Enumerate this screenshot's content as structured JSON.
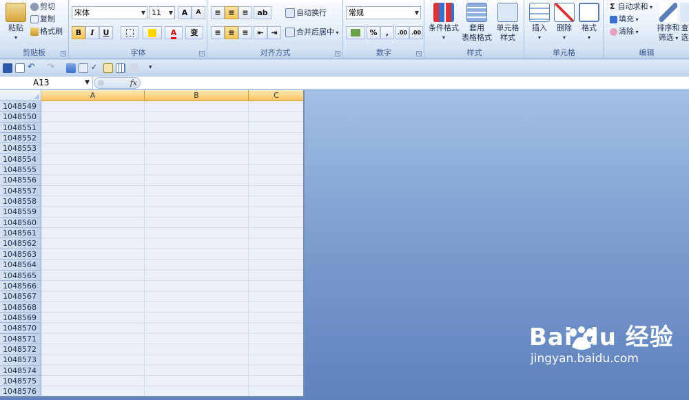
{
  "ribbon": {
    "clipboard": {
      "label": "剪贴板",
      "paste": "粘贴",
      "cut": "剪切",
      "copy": "复制",
      "format_painter": "格式刷"
    },
    "font": {
      "label": "字体",
      "font_name": "宋体",
      "font_size": "11",
      "bold": "B",
      "italic": "I",
      "underline": "U",
      "grow": "A",
      "shrink": "A",
      "font_color": "A",
      "phonetic": "变"
    },
    "alignment": {
      "label": "对齐方式",
      "wrap_text": "自动换行",
      "merge_center": "合并后居中"
    },
    "number": {
      "label": "数字",
      "format": "常规",
      "percent": "%",
      "comma": ",",
      "inc_decimal": ".00",
      "dec_decimal": ".00"
    },
    "styles": {
      "label": "样式",
      "conditional": "条件格式",
      "table_format_1": "套用",
      "table_format_2": "表格格式",
      "cell_styles_1": "单元格",
      "cell_styles_2": "样式"
    },
    "cells": {
      "label": "单元格",
      "insert": "插入",
      "delete": "删除",
      "format": "格式"
    },
    "editing": {
      "label": "编辑",
      "autosum": "自动求和",
      "fill": "填充",
      "clear": "清除",
      "sort_1": "排序和",
      "sort_2": "筛选",
      "find_1": "查",
      "find_2": "选"
    }
  },
  "formula_bar": {
    "name_box": "A13",
    "fx": "fx",
    "content": ""
  },
  "sheet": {
    "columns": [
      "A",
      "B",
      "C"
    ],
    "rows": [
      "1048549",
      "1048550",
      "1048551",
      "1048552",
      "1048553",
      "1048554",
      "1048555",
      "1048556",
      "1048557",
      "1048558",
      "1048559",
      "1048560",
      "1048561",
      "1048562",
      "1048563",
      "1048564",
      "1048565",
      "1048566",
      "1048567",
      "1048568",
      "1048569",
      "1048570",
      "1048571",
      "1048572",
      "1048573",
      "1048574",
      "1048575",
      "1048576"
    ]
  },
  "watermark": {
    "logo": "Bai du 经验",
    "url": "jingyan.baidu.com"
  },
  "colors": {
    "accent_header": "#f7c45e",
    "ribbon_text": "#15428b",
    "workspace": "#7e9fd0"
  }
}
